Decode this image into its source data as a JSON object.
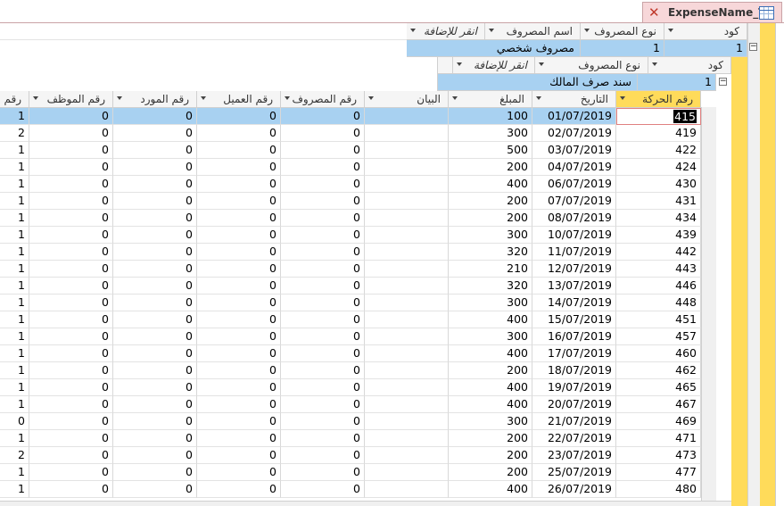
{
  "tab": {
    "title": "ExpenseName_T"
  },
  "level1": {
    "headers": [
      "كود",
      "نوع المصروف",
      "اسم المصروف",
      "انقر للإضافة"
    ],
    "row": {
      "code": "1",
      "type": "1",
      "name": "مصروف شخصي"
    }
  },
  "level2": {
    "headers": [
      "كود",
      "نوع المصروف",
      "انقر للإضافة"
    ],
    "row": {
      "code": "1",
      "type": "سند صرف المالك"
    }
  },
  "level3": {
    "headers": [
      "رقم الحركة",
      "التاريخ",
      "المبلغ",
      "البيان",
      "رقم المصروف",
      "رقم العميل",
      "رقم المورد",
      "رقم الموظف",
      "رقم"
    ],
    "rows": [
      [
        "415",
        "01/07/2019",
        "100",
        "",
        "0",
        "0",
        "0",
        "0",
        "1"
      ],
      [
        "419",
        "02/07/2019",
        "300",
        "",
        "0",
        "0",
        "0",
        "0",
        "2"
      ],
      [
        "422",
        "03/07/2019",
        "500",
        "",
        "0",
        "0",
        "0",
        "0",
        "1"
      ],
      [
        "424",
        "04/07/2019",
        "200",
        "",
        "0",
        "0",
        "0",
        "0",
        "1"
      ],
      [
        "430",
        "06/07/2019",
        "400",
        "",
        "0",
        "0",
        "0",
        "0",
        "1"
      ],
      [
        "431",
        "07/07/2019",
        "200",
        "",
        "0",
        "0",
        "0",
        "0",
        "1"
      ],
      [
        "434",
        "08/07/2019",
        "200",
        "",
        "0",
        "0",
        "0",
        "0",
        "1"
      ],
      [
        "439",
        "10/07/2019",
        "300",
        "",
        "0",
        "0",
        "0",
        "0",
        "1"
      ],
      [
        "442",
        "11/07/2019",
        "320",
        "",
        "0",
        "0",
        "0",
        "0",
        "1"
      ],
      [
        "443",
        "12/07/2019",
        "210",
        "",
        "0",
        "0",
        "0",
        "0",
        "1"
      ],
      [
        "446",
        "13/07/2019",
        "320",
        "",
        "0",
        "0",
        "0",
        "0",
        "1"
      ],
      [
        "448",
        "14/07/2019",
        "300",
        "",
        "0",
        "0",
        "0",
        "0",
        "1"
      ],
      [
        "451",
        "15/07/2019",
        "400",
        "",
        "0",
        "0",
        "0",
        "0",
        "1"
      ],
      [
        "457",
        "16/07/2019",
        "300",
        "",
        "0",
        "0",
        "0",
        "0",
        "1"
      ],
      [
        "460",
        "17/07/2019",
        "400",
        "",
        "0",
        "0",
        "0",
        "0",
        "1"
      ],
      [
        "462",
        "18/07/2019",
        "200",
        "",
        "0",
        "0",
        "0",
        "0",
        "1"
      ],
      [
        "465",
        "19/07/2019",
        "400",
        "",
        "0",
        "0",
        "0",
        "0",
        "1"
      ],
      [
        "467",
        "20/07/2019",
        "400",
        "",
        "0",
        "0",
        "0",
        "0",
        "1"
      ],
      [
        "469",
        "21/07/2019",
        "300",
        "",
        "0",
        "0",
        "0",
        "0",
        "0"
      ],
      [
        "471",
        "22/07/2019",
        "200",
        "",
        "0",
        "0",
        "0",
        "0",
        "1"
      ],
      [
        "473",
        "23/07/2019",
        "200",
        "",
        "0",
        "0",
        "0",
        "0",
        "2"
      ],
      [
        "477",
        "25/07/2019",
        "200",
        "",
        "0",
        "0",
        "0",
        "0",
        "1"
      ],
      [
        "480",
        "26/07/2019",
        "400",
        "",
        "0",
        "0",
        "0",
        "0",
        "1"
      ]
    ]
  },
  "colors": {
    "selection": "#a8d1f1",
    "accent_yellow": "#ffdb5a",
    "tab": "#f7d7d9"
  }
}
